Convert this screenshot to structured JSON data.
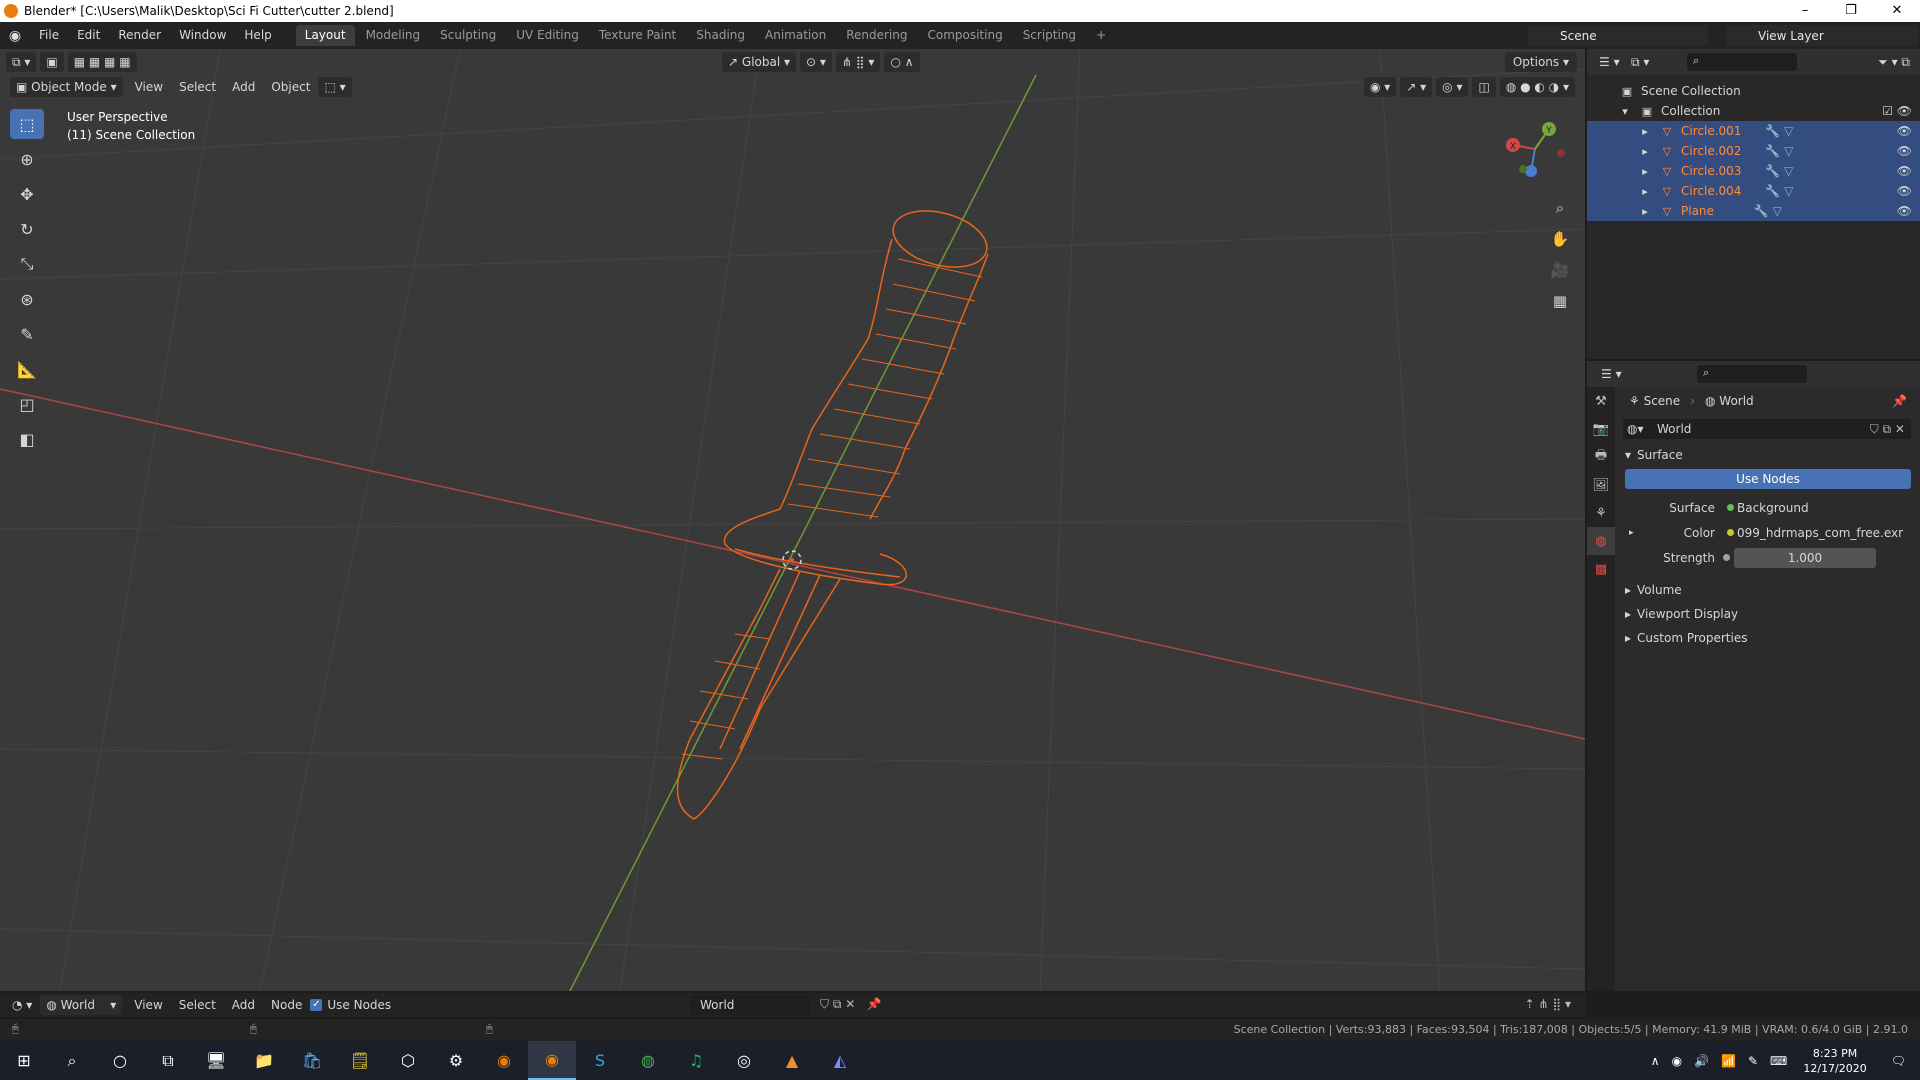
{
  "window": {
    "title": "Blender* [C:\\Users\\Malik\\Desktop\\Sci Fi Cutter\\cutter 2.blend]",
    "controls": [
      "–",
      "❐",
      "✕"
    ]
  },
  "topbar": {
    "menus": [
      "File",
      "Edit",
      "Render",
      "Window",
      "Help"
    ],
    "workspaces": [
      "Layout",
      "Modeling",
      "Sculpting",
      "UV Editing",
      "Texture Paint",
      "Shading",
      "Animation",
      "Rendering",
      "Compositing",
      "Scripting"
    ],
    "active_workspace": "Layout",
    "add_tab": "+",
    "scene": "Scene",
    "view_layer": "View Layer"
  },
  "viewport": {
    "orientation": "Global",
    "options": "Options",
    "mode": "Object Mode",
    "menus": [
      "View",
      "Select",
      "Add",
      "Object"
    ],
    "info_line1": "User Perspective",
    "info_line2": "(11) Scene Collection",
    "gizmo_axes": [
      "X",
      "Y"
    ],
    "wire_color": "#e8651a",
    "x_axis_color": "#c84848",
    "y_axis_color": "#7ca63c"
  },
  "outliner": {
    "root": "Scene Collection",
    "collection": "Collection",
    "objects": [
      "Circle.001",
      "Circle.002",
      "Circle.003",
      "Circle.004",
      "Plane"
    ]
  },
  "properties": {
    "breadcrumb_scene": "Scene",
    "breadcrumb_world": "World",
    "world_name": "World",
    "surface_panel": "Surface",
    "use_nodes": "Use Nodes",
    "surface_label": "Surface",
    "surface_value": "Background",
    "color_label": "Color",
    "color_value": "099_hdrmaps_com_free.exr",
    "strength_label": "Strength",
    "strength_value": "1.000",
    "closed_panels": [
      "Volume",
      "Viewport Display",
      "Custom Properties"
    ]
  },
  "node_editor": {
    "type": "World",
    "menus": [
      "View",
      "Select",
      "Add",
      "Node"
    ],
    "use_nodes": "Use Nodes",
    "world": "World"
  },
  "statusbar": {
    "stats": "Scene Collection | Verts:93,883 | Faces:93,504 | Tris:187,008 | Objects:5/5 | Memory: 41.9 MiB | VRAM: 0.6/4.0 GiB | 2.91.0"
  },
  "taskbar": {
    "time": "8:23 PM",
    "date": "12/17/2020"
  }
}
